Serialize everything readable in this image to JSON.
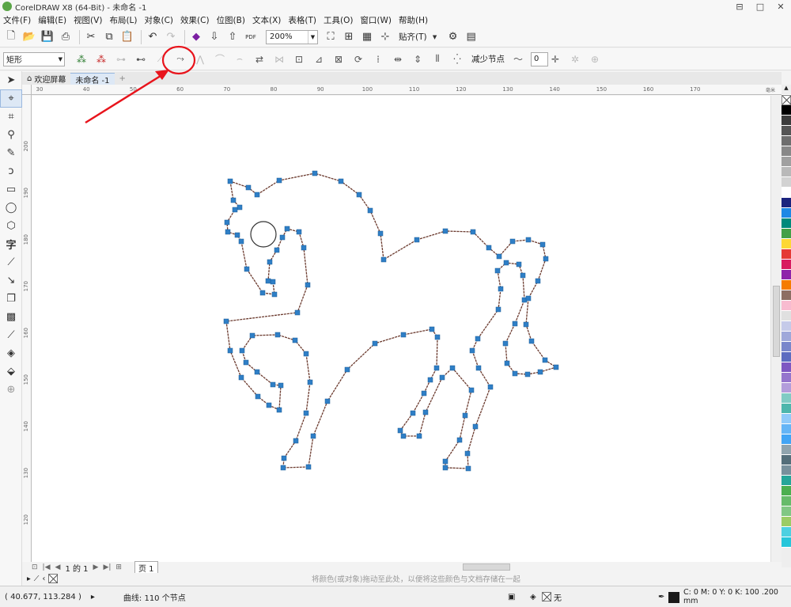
{
  "app": {
    "title": "CorelDRAW X8 (64-Bit) - 未命名 -1"
  },
  "window_controls": {
    "minimize": "⊟",
    "restore": "□",
    "close": "✕"
  },
  "menu": [
    "文件(F)",
    "编辑(E)",
    "视图(V)",
    "布局(L)",
    "对象(C)",
    "效果(C)",
    "位图(B)",
    "文本(X)",
    "表格(T)",
    "工具(O)",
    "窗口(W)",
    "帮助(H)"
  ],
  "standard_toolbar": {
    "zoom_level": "200%",
    "snap_label": "贴齐(T)",
    "pdf_label": "PDF"
  },
  "property_bar": {
    "shape_select": "矩形",
    "reduce_nodes": "减少节点",
    "smoothness": "0"
  },
  "doc_tabs": {
    "welcome": "欢迎屏幕",
    "active": "未命名 -1",
    "add": "+"
  },
  "hruler_ticks": [
    "30",
    "40",
    "50",
    "60",
    "70",
    "80",
    "90",
    "100",
    "110",
    "120",
    "130",
    "140",
    "150",
    "160",
    "170"
  ],
  "hruler_unit": "毫米",
  "vruler_ticks": [
    "200",
    "190",
    "180",
    "170",
    "160",
    "150",
    "140",
    "130",
    "120"
  ],
  "page_nav": {
    "page_count": "1 的 1",
    "page_tab": "页 1"
  },
  "hint": "将颜色(或对象)拖动至此处，以便将这些颜色与文档存储在一起",
  "status": {
    "coordinates": "( 40.677, 113.284 )",
    "object_info": "曲线: 110 个节点",
    "fill": "无",
    "outline": "C: 0 M: 0 Y: 0 K: 100  .200 mm"
  },
  "palette_colors": [
    "#000000",
    "#3c3c3c",
    "#555555",
    "#6e6e6e",
    "#888888",
    "#a0a0a0",
    "#b9b9b9",
    "#d2d2d2",
    "#ffffff",
    "#1a237e",
    "#1e88e5",
    "#00897b",
    "#43a047",
    "#fdd835",
    "#e53935",
    "#d81b60",
    "#8e24aa",
    "#f57c00",
    "#8d6e63",
    "#f8bbd0",
    "#e0e0e0",
    "#c5cae9",
    "#9fa8da",
    "#7986cb",
    "#5c6bc0",
    "#7e57c2",
    "#9575cd",
    "#b39ddb",
    "#80cbc4",
    "#4db6ac",
    "#90caf9",
    "#64b5f6",
    "#42a5f5",
    "#90a4ae",
    "#546e7a",
    "#78909c",
    "#26a69a",
    "#4caf50",
    "#66bb6a",
    "#81c784",
    "#9ccc65",
    "#4dd0e1",
    "#26c6da"
  ]
}
